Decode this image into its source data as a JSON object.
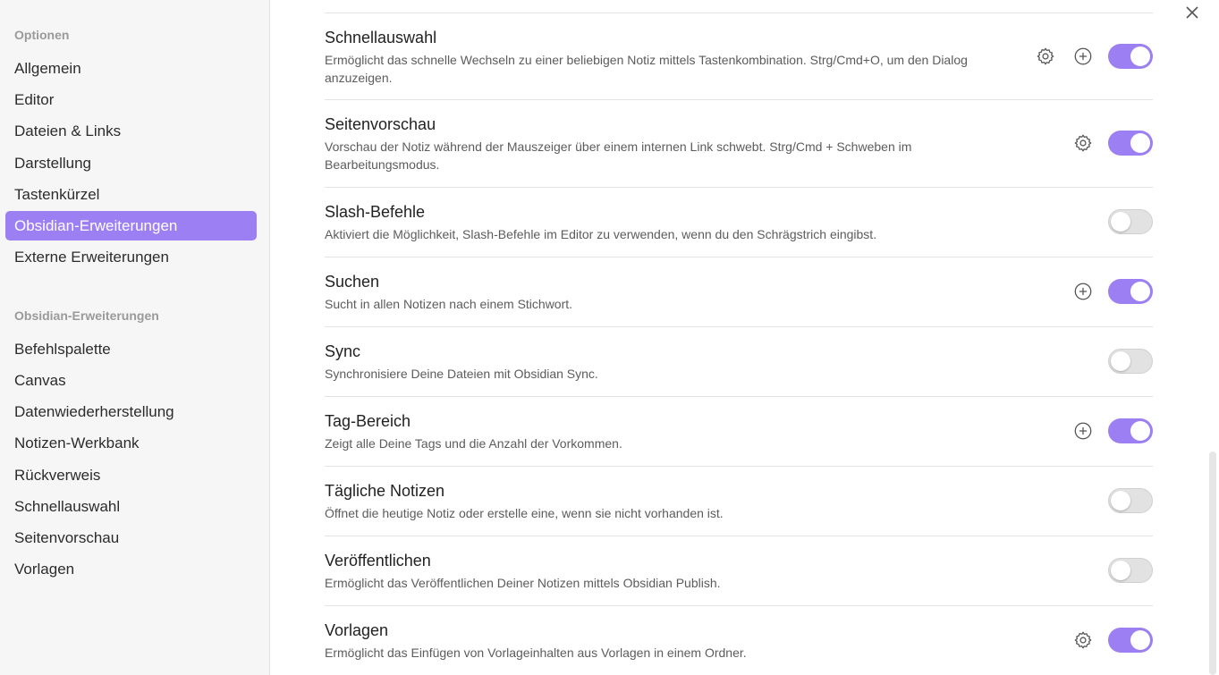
{
  "sidebar": {
    "section_options": "Optionen",
    "options": [
      "Allgemein",
      "Editor",
      "Dateien & Links",
      "Darstellung",
      "Tastenkürzel",
      "Obsidian-Erweiterungen",
      "Externe Erweiterungen"
    ],
    "active_item": "Obsidian-Erweiterungen",
    "section_plugins": "Obsidian-Erweiterungen",
    "plugins": [
      "Befehlspalette",
      "Canvas",
      "Datenwiederherstellung",
      "Notizen-Werkbank",
      "Rückverweis",
      "Schnellauswahl",
      "Seitenvorschau",
      "Vorlagen"
    ]
  },
  "plugins": [
    {
      "title": "Schnellauswahl",
      "description": "Ermöglicht das schnelle Wechseln zu einer beliebigen Notiz mittels Tastenkombination. Strg/Cmd+O, um den Dialog anzuzeigen.",
      "settings_icon": true,
      "hotkey_icon": true,
      "enabled": true
    },
    {
      "title": "Seitenvorschau",
      "description": "Vorschau der Notiz während der Mauszeiger über einem internen Link schwebt. Strg/Cmd + Schweben im Bearbeitungsmodus.",
      "settings_icon": true,
      "hotkey_icon": false,
      "enabled": true
    },
    {
      "title": "Slash-Befehle",
      "description": "Aktiviert die Möglichkeit, Slash-Befehle im Editor zu verwenden, wenn du den Schrägstrich eingibst.",
      "settings_icon": false,
      "hotkey_icon": false,
      "enabled": false
    },
    {
      "title": "Suchen",
      "description": "Sucht in allen Notizen nach einem Stichwort.",
      "settings_icon": false,
      "hotkey_icon": true,
      "enabled": true
    },
    {
      "title": "Sync",
      "description": "Synchronisiere Deine Dateien mit Obsidian Sync.",
      "settings_icon": false,
      "hotkey_icon": false,
      "enabled": false
    },
    {
      "title": "Tag-Bereich",
      "description": "Zeigt alle Deine Tags und die Anzahl der Vorkommen.",
      "settings_icon": false,
      "hotkey_icon": true,
      "enabled": true
    },
    {
      "title": "Tägliche Notizen",
      "description": "Öffnet die heutige Notiz oder erstelle eine, wenn sie nicht vorhanden ist.",
      "settings_icon": false,
      "hotkey_icon": false,
      "enabled": false
    },
    {
      "title": "Veröffentlichen",
      "description": "Ermöglicht das Veröffentlichen Deiner Notizen mittels Obsidian Publish.",
      "settings_icon": false,
      "hotkey_icon": false,
      "enabled": false
    },
    {
      "title": "Vorlagen",
      "description": "Ermöglicht das Einfügen von Vorlageinhalten aus Vorlagen in einem Ordner.",
      "settings_icon": true,
      "hotkey_icon": false,
      "enabled": true
    }
  ],
  "colors": {
    "accent": "#9b7ff3",
    "toggle_off": "#e2e2e2",
    "sidebar_bg": "#f6f6f6"
  },
  "icons": {
    "settings": "gear-icon",
    "hotkey": "plus-circle-icon",
    "close": "close-icon"
  }
}
